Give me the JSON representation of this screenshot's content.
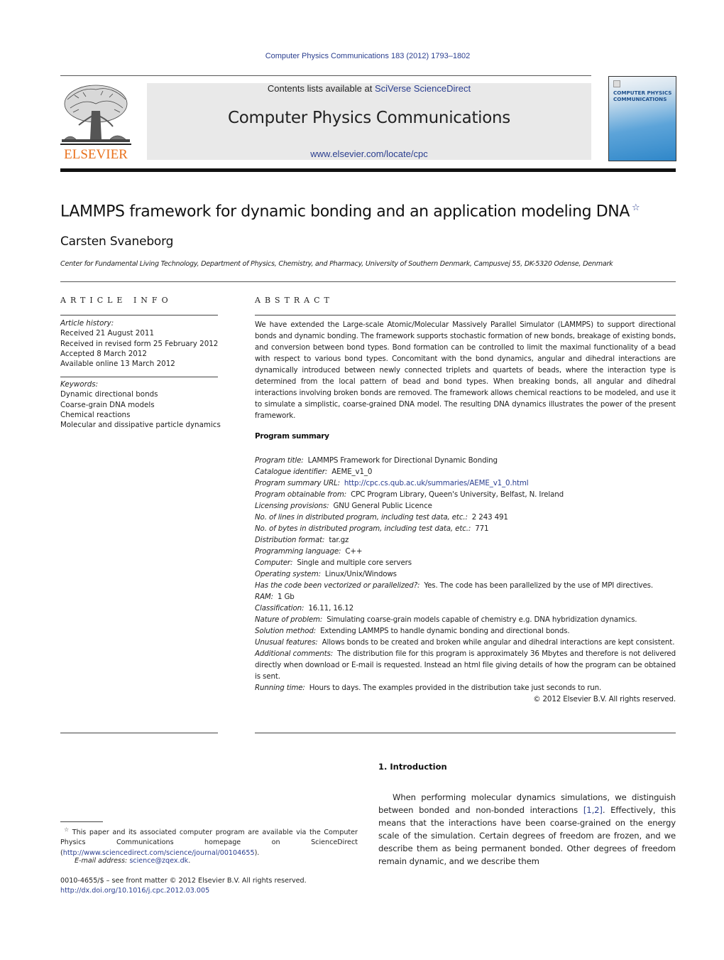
{
  "header": {
    "journal_ref": "Computer Physics Communications 183 (2012) 1793–1802",
    "publisher_logo_text": "ELSEVIER",
    "contents_prefix": "Contents lists available at ",
    "contents_link": "SciVerse ScienceDirect",
    "journal_title": "Computer Physics Communications",
    "journal_url": "www.elsevier.com/locate/cpc",
    "cover_title_line1": "COMPUTER PHYSICS",
    "cover_title_line2": "COMMUNICATIONS"
  },
  "article": {
    "title": "LAMMPS framework for dynamic bonding and an application modeling DNA",
    "title_footnote_mark": "☆",
    "author": "Carsten Svaneborg",
    "affiliation": "Center for Fundamental Living Technology, Department of Physics, Chemistry, and Pharmacy, University of Southern Denmark, Campusvej 55, DK-5320 Odense, Denmark"
  },
  "article_info": {
    "heading": "ARTICLE INFO",
    "history_label": "Article history:",
    "history": [
      "Received 21 August 2011",
      "Received in revised form 25 February 2012",
      "Accepted 8 March 2012",
      "Available online 13 March 2012"
    ],
    "keywords_label": "Keywords:",
    "keywords": [
      "Dynamic directional bonds",
      "Coarse-grain DNA models",
      "Chemical reactions",
      "Molecular and dissipative particle dynamics"
    ]
  },
  "abstract": {
    "heading": "ABSTRACT",
    "text": "We have extended the Large-scale Atomic/Molecular Massively Parallel Simulator (LAMMPS) to support directional bonds and dynamic bonding. The framework supports stochastic formation of new bonds, breakage of existing bonds, and conversion between bond types. Bond formation can be controlled to limit the maximal functionality of a bead with respect to various bond types. Concomitant with the bond dynamics, angular and dihedral interactions are dynamically introduced between newly connected triplets and quartets of beads, where the interaction type is determined from the local pattern of bead and bond types. When breaking bonds, all angular and dihedral interactions involving broken bonds are removed. The framework allows chemical reactions to be modeled, and use it to simulate a simplistic, coarse-grained DNA model. The resulting DNA dynamics illustrates the power of the present framework."
  },
  "program_summary": {
    "heading": "Program summary",
    "items": [
      {
        "label": "Program title:",
        "value": "LAMMPS Framework for Directional Dynamic Bonding"
      },
      {
        "label": "Catalogue identifier:",
        "value": "AEME_v1_0"
      },
      {
        "label": "Program summary URL:",
        "value": "http://cpc.cs.qub.ac.uk/summaries/AEME_v1_0.html"
      },
      {
        "label": "Program obtainable from:",
        "value": "CPC Program Library, Queen's University, Belfast, N. Ireland"
      },
      {
        "label": "Licensing provisions:",
        "value": "GNU General Public Licence"
      },
      {
        "label": "No. of lines in distributed program, including test data, etc.:",
        "value": "2 243 491"
      },
      {
        "label": "No. of bytes in distributed program, including test data, etc.:",
        "value": "771"
      },
      {
        "label": "Distribution format:",
        "value": "tar.gz"
      },
      {
        "label": "Programming language:",
        "value": "C++"
      },
      {
        "label": "Computer:",
        "value": "Single and multiple core servers"
      },
      {
        "label": "Operating system:",
        "value": "Linux/Unix/Windows"
      },
      {
        "label": "Has the code been vectorized or parallelized?:",
        "value": "Yes. The code has been parallelized by the use of MPI directives."
      },
      {
        "label": "RAM:",
        "value": "1 Gb"
      },
      {
        "label": "Classification:",
        "value": "16.11, 16.12"
      },
      {
        "label": "Nature of problem:",
        "value": "Simulating coarse-grain models capable of chemistry e.g. DNA hybridization dynamics."
      },
      {
        "label": "Solution method:",
        "value": "Extending LAMMPS to handle dynamic bonding and directional bonds."
      },
      {
        "label": "Unusual features:",
        "value": "Allows bonds to be created and broken while angular and dihedral interactions are kept consistent."
      },
      {
        "label": "Additional comments:",
        "value": "The distribution file for this program is approximately 36 Mbytes and therefore is not delivered directly when download or E-mail is requested. Instead an html file giving details of how the program can be obtained is sent."
      },
      {
        "label": "Running time:",
        "value": "Hours to days. The examples provided in the distribution take just seconds to run."
      }
    ],
    "copyright": "© 2012 Elsevier B.V. All rights reserved."
  },
  "introduction": {
    "heading": "1.  Introduction",
    "text_before_ref": "When performing molecular dynamics simulations, we distinguish between bonded and non-bonded interactions ",
    "ref": "[1,2]",
    "text_after_ref": ". Effectively, this means that the interactions have been coarse-grained on the energy scale of the simulation. Certain degrees of freedom are frozen, and we describe them as being permanent bonded. Other degrees of freedom remain dynamic, and we describe them"
  },
  "footnotes": {
    "star_mark": "☆",
    "note_text": "This paper and its associated computer program are available via the Computer Physics Communications homepage on ScienceDirect (",
    "note_link": "http://www.sciencedirect.com/science/journal/00104655",
    "note_end": ").",
    "email_label": "E-mail address: ",
    "email": "science@zqex.dk",
    "email_end": ".",
    "front_matter": "0010-4655/$ – see front matter  © 2012 Elsevier B.V. All rights reserved.",
    "doi": "http://dx.doi.org/10.1016/j.cpc.2012.03.005"
  },
  "colors": {
    "link": "#2a3e8f",
    "elsevier_orange": "#e9711c",
    "banner_gray": "#e9e9e9"
  }
}
